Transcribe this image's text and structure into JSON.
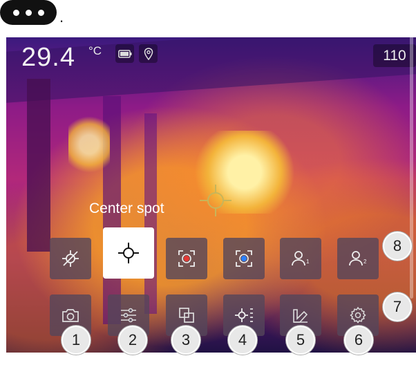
{
  "top": {
    "period": "."
  },
  "display": {
    "temperature": "29.4",
    "unit": "°C",
    "right_value": "110",
    "tooltip": "Center spot"
  },
  "toolbar": {
    "row1": [
      "no-measurement",
      "center-spot",
      "hot-spot",
      "cold-spot",
      "user-preset-1",
      "user-preset-2"
    ],
    "row2": [
      "camera",
      "adjustments",
      "image-mode",
      "measurement",
      "color-palette",
      "settings"
    ],
    "selected": "center-spot"
  },
  "callouts": [
    "1",
    "2",
    "3",
    "4",
    "5",
    "6",
    "7",
    "8"
  ],
  "colors": {
    "hot_marker": "#e53935",
    "cold_marker": "#2b7fff",
    "screen_bg": "#8d1b87"
  }
}
